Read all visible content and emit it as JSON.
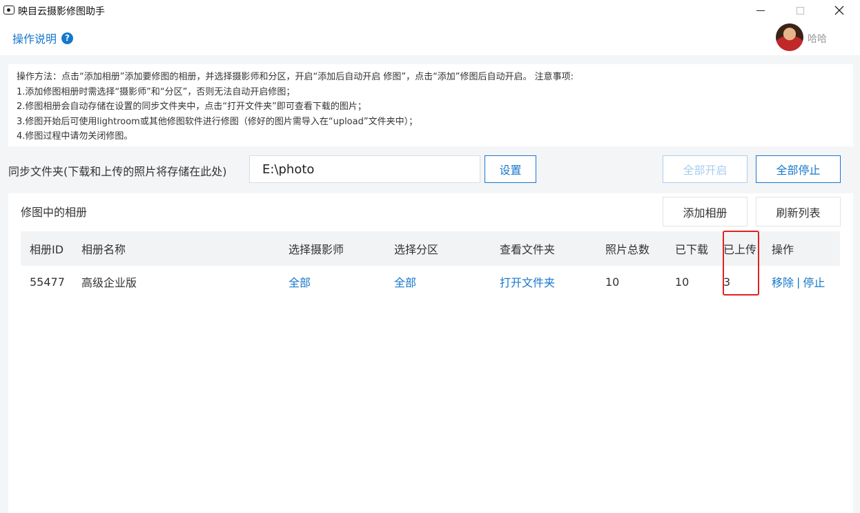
{
  "window": {
    "title": "映目云摄影修图助手",
    "icon": "camera-icon"
  },
  "header": {
    "help_label": "操作说明",
    "help_icon": "question-circle-icon",
    "help_icon_glyph": "?",
    "user_name": "哈哈"
  },
  "instructions": {
    "lines": [
      "操作方法：点击“添加相册”添加要修图的相册，并选择摄影师和分区，开启“添加后自动开启 修图”，点击“添加”修图后自动开启。 注意事项:",
      "1.添加修图相册时需选择“摄影师”和“分区”，否则无法自动开启修图；",
      "2.修图相册会自动存储在设置的同步文件夹中，点击“打开文件夹”即可查看下载的图片；",
      "3.修图开始后可使用lightroom或其他修图软件进行修图（修好的图片需导入在“upload”文件夹中）；",
      "4.修图过程中请勿关闭修图。"
    ]
  },
  "sync": {
    "label": "同步文件夹(下载和上传的照片将存储在此处)",
    "path": "E:\\photo",
    "settings_label": "设置",
    "start_all_label": "全部开启",
    "stop_all_label": "全部停止"
  },
  "albums": {
    "title": "修图中的相册",
    "add_label": "添加相册",
    "refresh_label": "刷新列表",
    "columns": [
      "相册ID",
      "相册名称",
      "选择摄影师",
      "选择分区",
      "查看文件夹",
      "照片总数",
      "已下载",
      "已上传",
      "操作"
    ],
    "rows": [
      {
        "id": "55477",
        "name": "高级企业版",
        "photographer": "全部",
        "partition": "全部",
        "folder": "打开文件夹",
        "total": "10",
        "downloaded": "10",
        "uploaded": "3",
        "remove": "移除",
        "separator": "|",
        "stop": "停止"
      }
    ]
  },
  "colors": {
    "accent": "#1677cc",
    "disabled": "#a9cdef",
    "highlight": "#e02020",
    "background": "#f4f5f7"
  }
}
